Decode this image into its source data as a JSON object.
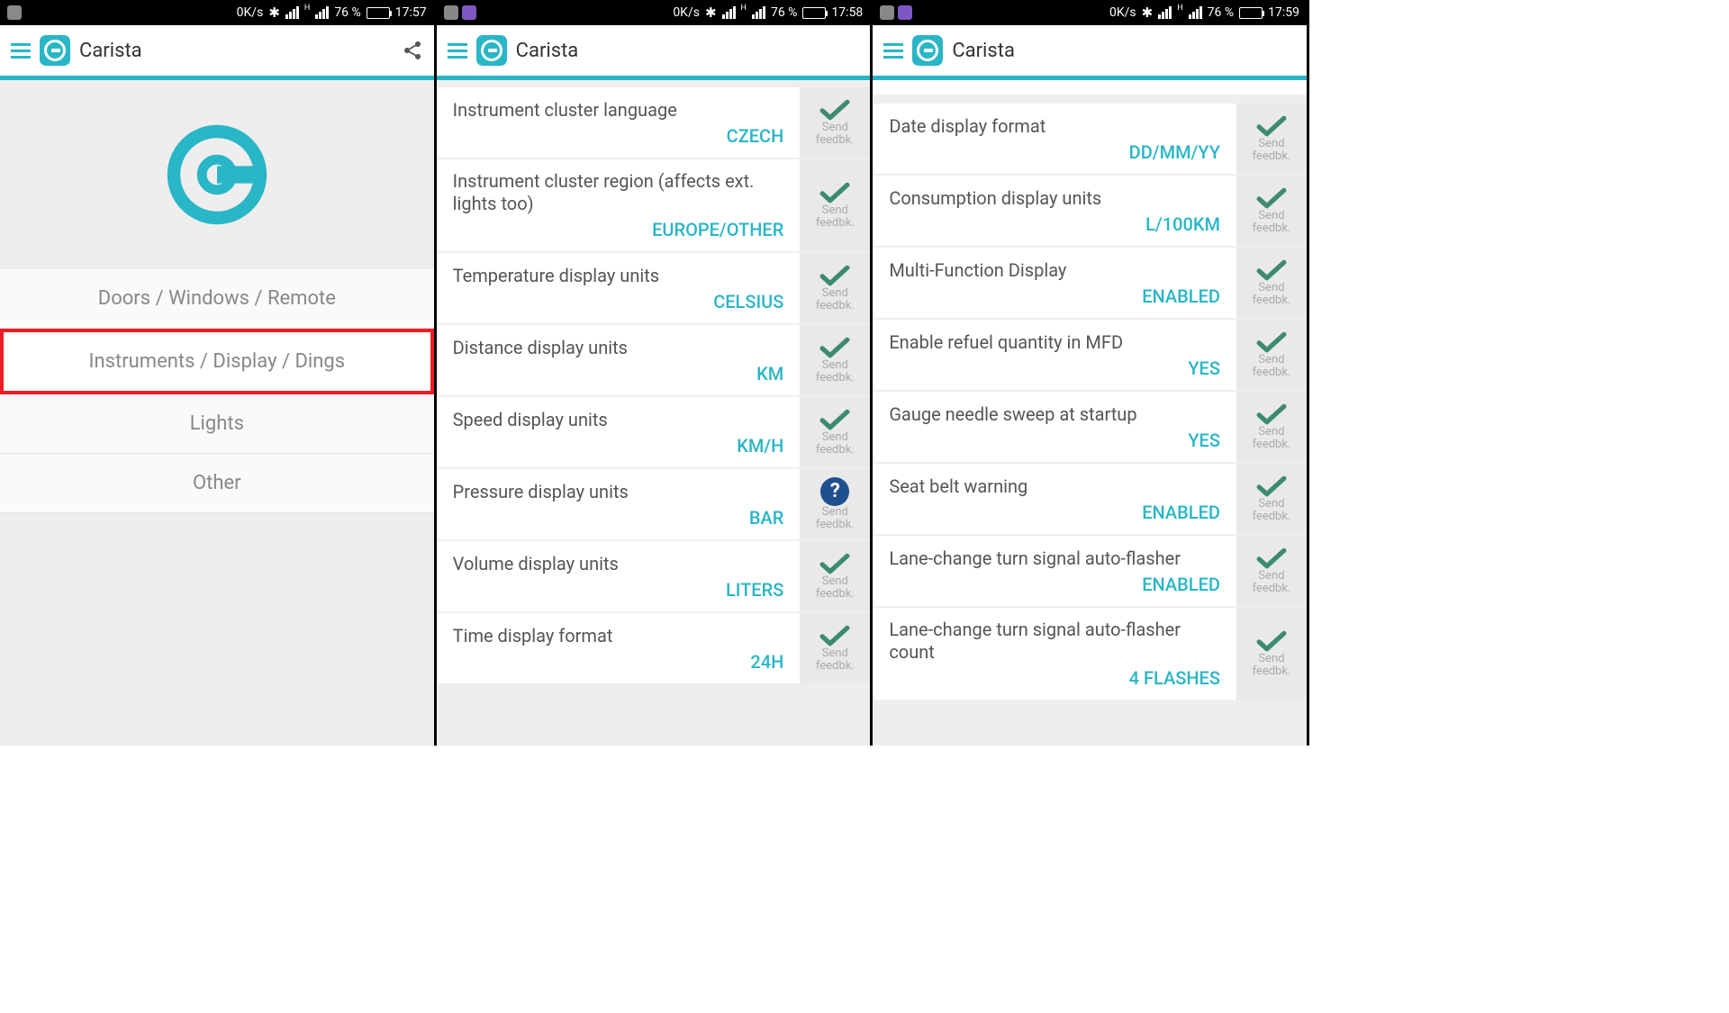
{
  "status": {
    "speed": "0K/s",
    "signal_label": "H",
    "battery_pct": "76 %"
  },
  "app_name": "Carista",
  "feedback": {
    "send": "Send",
    "fb": "feedbk."
  },
  "screen1": {
    "time": "17:57",
    "menu": [
      {
        "label": "Doors / Windows / Remote",
        "highlight": false
      },
      {
        "label": "Instruments / Display / Dings",
        "highlight": true
      },
      {
        "label": "Lights",
        "highlight": false
      },
      {
        "label": "Other",
        "highlight": false
      }
    ]
  },
  "screen2": {
    "time": "17:58",
    "settings": [
      {
        "label": "Instrument cluster language",
        "value": "CZECH",
        "icon": "check"
      },
      {
        "label": "Instrument cluster region (affects ext. lights too)",
        "value": "EUROPE/OTHER",
        "icon": "check"
      },
      {
        "label": "Temperature display units",
        "value": "CELSIUS",
        "icon": "check"
      },
      {
        "label": "Distance display units",
        "value": "KM",
        "icon": "check"
      },
      {
        "label": "Speed display units",
        "value": "KM/H",
        "icon": "check"
      },
      {
        "label": "Pressure display units",
        "value": "BAR",
        "icon": "help"
      },
      {
        "label": "Volume display units",
        "value": "LITERS",
        "icon": "check"
      },
      {
        "label": "Time display format",
        "value": "24H",
        "icon": "check"
      }
    ]
  },
  "screen3": {
    "time": "17:59",
    "settings": [
      {
        "label": "Date display format",
        "value": "DD/MM/YY",
        "icon": "check"
      },
      {
        "label": "Consumption display units",
        "value": "L/100KM",
        "icon": "check"
      },
      {
        "label": "Multi-Function Display",
        "value": "ENABLED",
        "icon": "check"
      },
      {
        "label": "Enable refuel quantity in MFD",
        "value": "YES",
        "icon": "check"
      },
      {
        "label": "Gauge needle sweep at startup",
        "value": "YES",
        "icon": "check"
      },
      {
        "label": "Seat belt warning",
        "value": "ENABLED",
        "icon": "check"
      },
      {
        "label": "Lane-change turn signal auto-flasher",
        "value": "ENABLED",
        "icon": "check"
      },
      {
        "label": "Lane-change turn signal auto-flasher count",
        "value": "4 FLASHES",
        "icon": "check"
      }
    ]
  }
}
